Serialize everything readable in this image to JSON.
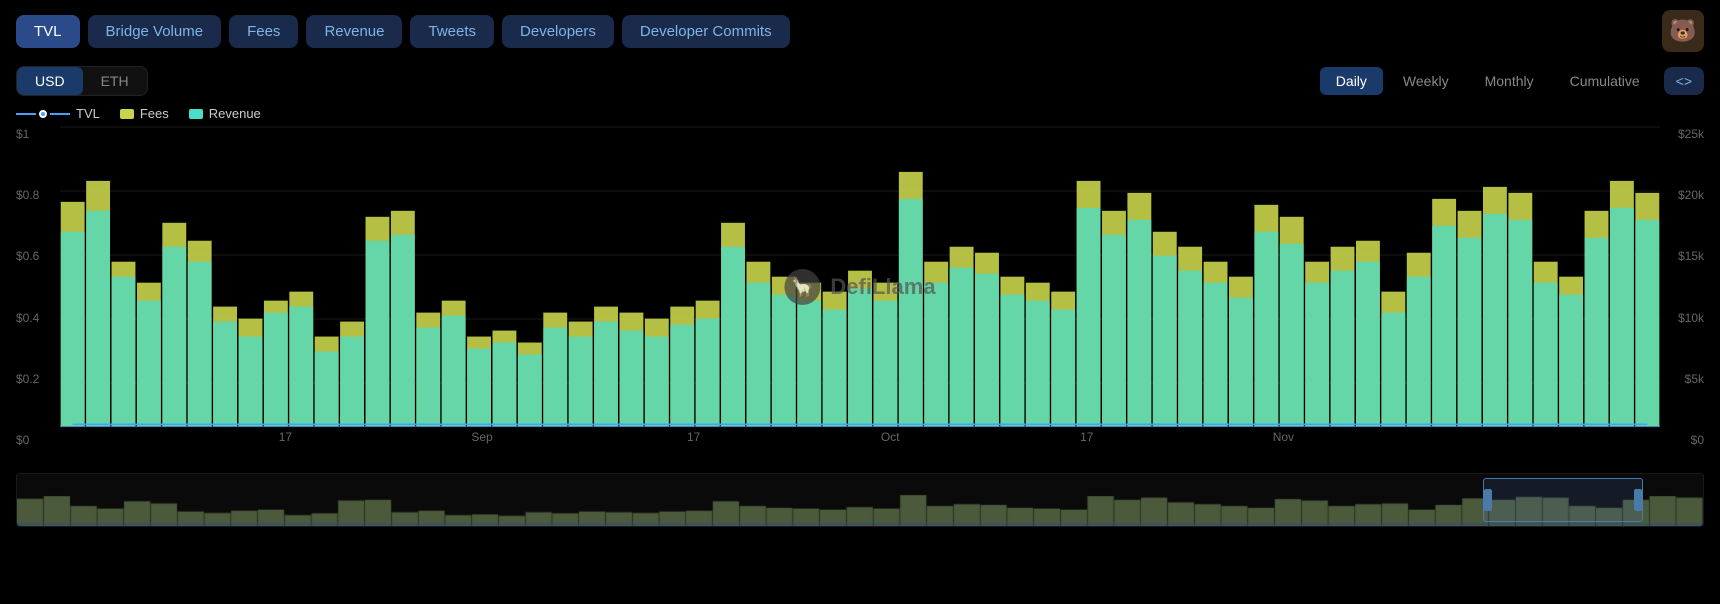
{
  "nav": {
    "buttons": [
      {
        "label": "TVL",
        "active": true
      },
      {
        "label": "Bridge Volume",
        "active": false
      },
      {
        "label": "Fees",
        "active": false
      },
      {
        "label": "Revenue",
        "active": false
      },
      {
        "label": "Tweets",
        "active": false
      },
      {
        "label": "Developers",
        "active": false
      },
      {
        "label": "Developer Commits",
        "active": false
      }
    ],
    "avatar_emoji": "🐻"
  },
  "currency": {
    "options": [
      "USD",
      "ETH"
    ],
    "active": "USD"
  },
  "time": {
    "options": [
      "Daily",
      "Weekly",
      "Monthly",
      "Cumulative"
    ],
    "active": "Daily"
  },
  "embed_label": "<>",
  "legend": [
    {
      "key": "tvl",
      "label": "TVL",
      "type": "dot-line"
    },
    {
      "key": "fees",
      "label": "Fees",
      "type": "bar"
    },
    {
      "key": "revenue",
      "label": "Revenue",
      "type": "bar"
    }
  ],
  "y_axis_left": [
    "$1",
    "$0.8",
    "$0.6",
    "$0.4",
    "$0.2",
    "$0"
  ],
  "y_axis_right": [
    "$25k",
    "$20k",
    "$15k",
    "$10k",
    "$5k",
    "$0"
  ],
  "x_labels": [
    {
      "label": "17",
      "pct": 12
    },
    {
      "label": "Sep",
      "pct": 25
    },
    {
      "label": "17",
      "pct": 39
    },
    {
      "label": "Oct",
      "pct": 52
    },
    {
      "label": "17",
      "pct": 65
    },
    {
      "label": "Nov",
      "pct": 78
    }
  ],
  "watermark": "DefiLlama",
  "chart": {
    "bars": [
      {
        "fees": 0.75,
        "revenue": 0.65
      },
      {
        "fees": 0.82,
        "revenue": 0.72
      },
      {
        "fees": 0.55,
        "revenue": 0.5
      },
      {
        "fees": 0.48,
        "revenue": 0.42
      },
      {
        "fees": 0.68,
        "revenue": 0.6
      },
      {
        "fees": 0.62,
        "revenue": 0.55
      },
      {
        "fees": 0.4,
        "revenue": 0.35
      },
      {
        "fees": 0.36,
        "revenue": 0.3
      },
      {
        "fees": 0.42,
        "revenue": 0.38
      },
      {
        "fees": 0.45,
        "revenue": 0.4
      },
      {
        "fees": 0.3,
        "revenue": 0.25
      },
      {
        "fees": 0.35,
        "revenue": 0.3
      },
      {
        "fees": 0.7,
        "revenue": 0.62
      },
      {
        "fees": 0.72,
        "revenue": 0.64
      },
      {
        "fees": 0.38,
        "revenue": 0.33
      },
      {
        "fees": 0.42,
        "revenue": 0.37
      },
      {
        "fees": 0.3,
        "revenue": 0.26
      },
      {
        "fees": 0.32,
        "revenue": 0.28
      },
      {
        "fees": 0.28,
        "revenue": 0.24
      },
      {
        "fees": 0.38,
        "revenue": 0.33
      },
      {
        "fees": 0.35,
        "revenue": 0.3
      },
      {
        "fees": 0.4,
        "revenue": 0.35
      },
      {
        "fees": 0.38,
        "revenue": 0.32
      },
      {
        "fees": 0.36,
        "revenue": 0.3
      },
      {
        "fees": 0.4,
        "revenue": 0.34
      },
      {
        "fees": 0.42,
        "revenue": 0.36
      },
      {
        "fees": 0.68,
        "revenue": 0.6
      },
      {
        "fees": 0.55,
        "revenue": 0.48
      },
      {
        "fees": 0.5,
        "revenue": 0.44
      },
      {
        "fees": 0.48,
        "revenue": 0.42
      },
      {
        "fees": 0.45,
        "revenue": 0.39
      },
      {
        "fees": 0.52,
        "revenue": 0.46
      },
      {
        "fees": 0.48,
        "revenue": 0.42
      },
      {
        "fees": 0.85,
        "revenue": 0.76
      },
      {
        "fees": 0.55,
        "revenue": 0.48
      },
      {
        "fees": 0.6,
        "revenue": 0.53
      },
      {
        "fees": 0.58,
        "revenue": 0.51
      },
      {
        "fees": 0.5,
        "revenue": 0.44
      },
      {
        "fees": 0.48,
        "revenue": 0.42
      },
      {
        "fees": 0.45,
        "revenue": 0.39
      },
      {
        "fees": 0.82,
        "revenue": 0.73
      },
      {
        "fees": 0.72,
        "revenue": 0.64
      },
      {
        "fees": 0.78,
        "revenue": 0.69
      },
      {
        "fees": 0.65,
        "revenue": 0.57
      },
      {
        "fees": 0.6,
        "revenue": 0.52
      },
      {
        "fees": 0.55,
        "revenue": 0.48
      },
      {
        "fees": 0.5,
        "revenue": 0.43
      },
      {
        "fees": 0.74,
        "revenue": 0.65
      },
      {
        "fees": 0.7,
        "revenue": 0.61
      },
      {
        "fees": 0.55,
        "revenue": 0.48
      },
      {
        "fees": 0.6,
        "revenue": 0.52
      },
      {
        "fees": 0.62,
        "revenue": 0.55
      },
      {
        "fees": 0.45,
        "revenue": 0.38
      },
      {
        "fees": 0.58,
        "revenue": 0.5
      },
      {
        "fees": 0.76,
        "revenue": 0.67
      },
      {
        "fees": 0.72,
        "revenue": 0.63
      },
      {
        "fees": 0.8,
        "revenue": 0.71
      },
      {
        "fees": 0.78,
        "revenue": 0.69
      },
      {
        "fees": 0.55,
        "revenue": 0.48
      },
      {
        "fees": 0.5,
        "revenue": 0.44
      },
      {
        "fees": 0.72,
        "revenue": 0.63
      },
      {
        "fees": 0.82,
        "revenue": 0.73
      },
      {
        "fees": 0.78,
        "revenue": 0.69
      }
    ]
  }
}
